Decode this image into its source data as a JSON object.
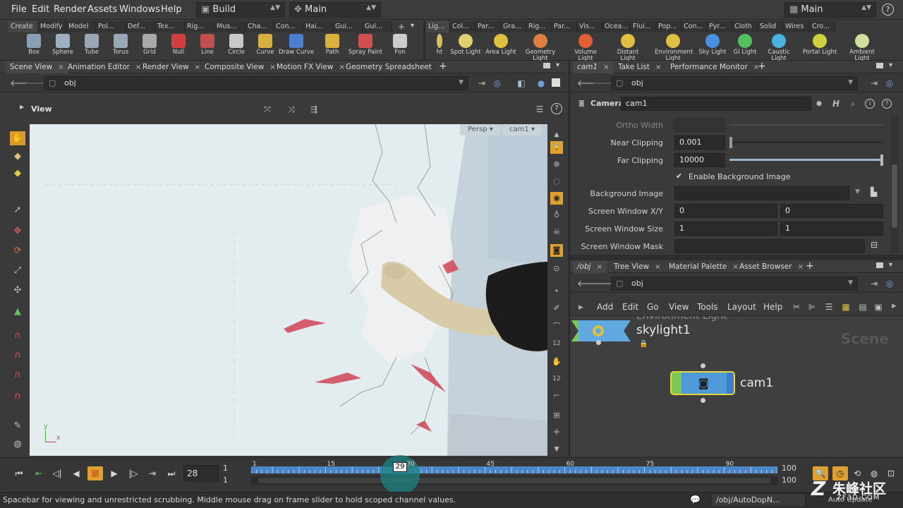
{
  "menubar": {
    "items": [
      "File",
      "Edit",
      "Render",
      "Assets",
      "Windows",
      "Help"
    ],
    "desktop": "Build",
    "context": "Main",
    "right_desktop": "Main"
  },
  "shelf": {
    "left_tabs": [
      "Create",
      "Modify",
      "Model",
      "Pol...",
      "Def...",
      "Tex...",
      "Rig...",
      "Mus...",
      "Cha...",
      "Con...",
      "Hai...",
      "Gui...",
      "Gui..."
    ],
    "right_tabs": [
      "Lig...",
      "Col...",
      "Par...",
      "Gra...",
      "Rig...",
      "Par...",
      "Vis...",
      "Ocea...",
      "Flui...",
      "Pop...",
      "Con...",
      "Pyr...",
      "Cloth",
      "Solid",
      "Wires",
      "Cro..."
    ],
    "left_tools": [
      {
        "label": "Box",
        "icon": "box-icon",
        "color": "#8aa0b4"
      },
      {
        "label": "Sphere",
        "icon": "sphere-icon",
        "color": "#9fb0c0"
      },
      {
        "label": "Tube",
        "icon": "tube-icon",
        "color": "#9aa8b6"
      },
      {
        "label": "Torus",
        "icon": "torus-icon",
        "color": "#9aa8b6"
      },
      {
        "label": "Grid",
        "icon": "grid-icon",
        "color": "#a8a8a8"
      },
      {
        "label": "Null",
        "icon": "null-icon",
        "color": "#d04040"
      },
      {
        "label": "Line",
        "icon": "line-icon",
        "color": "#c05050"
      },
      {
        "label": "Circle",
        "icon": "circle-icon",
        "color": "#c9c9c9"
      },
      {
        "label": "Curve",
        "icon": "curve-icon",
        "color": "#d8b040"
      },
      {
        "label": "Draw Curve",
        "icon": "draw-curve-icon",
        "color": "#4a7fd0"
      },
      {
        "label": "Path",
        "icon": "path-icon",
        "color": "#d8b040"
      },
      {
        "label": "Spray Paint",
        "icon": "spray-paint-icon",
        "color": "#d05050"
      },
      {
        "label": "Fon",
        "icon": "font-icon",
        "color": "#cccccc"
      }
    ],
    "right_tools": [
      {
        "label": "ht",
        "icon": "light-icon",
        "color": "#d8c060"
      },
      {
        "label": "Spot Light",
        "icon": "spot-light-icon",
        "color": "#e0d070"
      },
      {
        "label": "Area Light",
        "icon": "area-light-icon",
        "color": "#e0c040"
      },
      {
        "label": "Geometry Light",
        "icon": "geometry-light-icon",
        "color": "#e08040"
      },
      {
        "label": "Volume Light",
        "icon": "volume-light-icon",
        "color": "#e06030"
      },
      {
        "label": "Distant Light",
        "icon": "distant-light-icon",
        "color": "#e0c040"
      },
      {
        "label": "Environment Light",
        "icon": "environment-light-icon",
        "color": "#e0c040"
      },
      {
        "label": "Sky Light",
        "icon": "sky-light-icon",
        "color": "#4a90e0"
      },
      {
        "label": "GI Light",
        "icon": "gi-light-icon",
        "color": "#50c060"
      },
      {
        "label": "Caustic Light",
        "icon": "caustic-light-icon",
        "color": "#4ab0e0"
      },
      {
        "label": "Portal Light",
        "icon": "portal-light-icon",
        "color": "#d0d040"
      },
      {
        "label": "Ambient Light",
        "icon": "ambient-light-icon",
        "color": "#d0e0a0"
      }
    ]
  },
  "left_pane": {
    "tabs": [
      "Scene View",
      "Animation Editor",
      "Render View",
      "Composite View",
      "Motion FX View",
      "Geometry Spreadsheet"
    ],
    "path": "obj",
    "view_label": "View",
    "persp": "Persp",
    "camera": "cam1",
    "axis_y": "y",
    "axis_x": "x"
  },
  "params": {
    "tabs": [
      "cam1",
      "Take List",
      "Performance Monitor"
    ],
    "path": "obj",
    "node_type": "Camera",
    "node_name": "cam1",
    "ortho_width_label": "Ortho Width",
    "near_label": "Near Clipping",
    "near_value": "0.001",
    "far_label": "Far Clipping",
    "far_value": "10000",
    "bg_enable_label": "Enable Background Image",
    "bg_image_label": "Background Image",
    "sw_xy_label": "Screen Window X/Y",
    "sw_x": "0",
    "sw_y": "0",
    "sw_size_label": "Screen Window Size",
    "sw_w": "1",
    "sw_h": "1",
    "sw_mask_label": "Screen Window Mask"
  },
  "network": {
    "tabs": [
      "/obj",
      "Tree View",
      "Material Palette",
      "Asset Browser"
    ],
    "path": "obj",
    "menu": [
      "Add",
      "Edit",
      "Go",
      "View",
      "Tools",
      "Layout",
      "Help"
    ],
    "scene_label": "Scene",
    "env_label": "Environment Light",
    "skylight_name": "skylight1",
    "cam_name": "cam1"
  },
  "timeline": {
    "current_frame": "28",
    "start": "1",
    "start2": "1",
    "end": "100",
    "end2": "100",
    "slider_frame": "29",
    "ticks": [
      "1",
      "15",
      "30",
      "45",
      "60",
      "75",
      "90"
    ],
    "playhead_fraction": 0.283
  },
  "status": {
    "message": "Spacebar for viewing and unrestricted scrubbing. Middle mouse drag on frame slider to hold scoped channel values.",
    "path": "/obj/AutoDopN...",
    "update": "Auto Update",
    "watermark": "朱峰社区",
    "watermark_sub": "ZF3D.COM"
  }
}
